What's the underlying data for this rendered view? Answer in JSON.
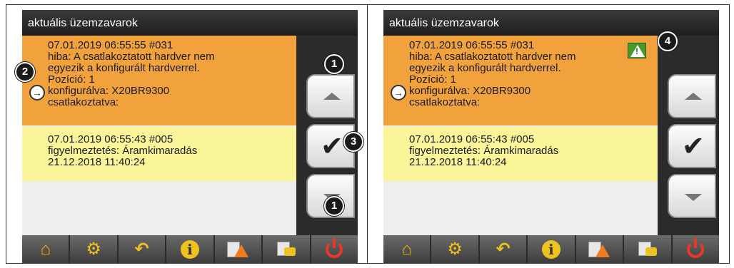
{
  "panels": [
    {
      "title": "aktuális üzemzavarok",
      "alarms": [
        {
          "lines": [
            "07.01.2019  06:55:55  #031",
            "hiba: A csatlakoztatott hardver nem",
            "egyezik a konfigurált hardverrel.",
            "Pozíció: 1",
            "konfigurálva: X20BR9300",
            "csatlakoztatva:"
          ]
        },
        {
          "lines": [
            "07.01.2019  06:55:43  #005",
            "figyelmeztetés: Áramkimaradás",
            "21.12.2018  11:40:24"
          ]
        }
      ],
      "callouts": [
        "1",
        "2",
        "3",
        "1"
      ]
    },
    {
      "title": "aktuális üzemzavarok",
      "alarms": [
        {
          "lines": [
            "07.01.2019  06:55:55  #031",
            "hiba: A csatlakoztatott hardver nem",
            "egyezik a konfigurált hardverrel.",
            "Pozíció: 1",
            "konfigurálva: X20BR9300",
            "csatlakoztatva:"
          ]
        },
        {
          "lines": [
            "07.01.2019  06:55:43  #005",
            "figyelmeztetés: Áramkimaradás",
            "21.12.2018  11:40:24"
          ]
        }
      ],
      "callouts": [
        "4"
      ]
    }
  ],
  "icons": {
    "arrow": "→",
    "check": "✔",
    "home": "⌂",
    "gear": "⚙",
    "back": "↶",
    "info": "i",
    "acknowledged_flag": "!"
  },
  "colors": {
    "error_row": "#f2a23c",
    "warning_row": "#fbf59a",
    "screen_bg": "#2b2b2b",
    "power": "#e8382a",
    "accent": "#f0c21e"
  }
}
